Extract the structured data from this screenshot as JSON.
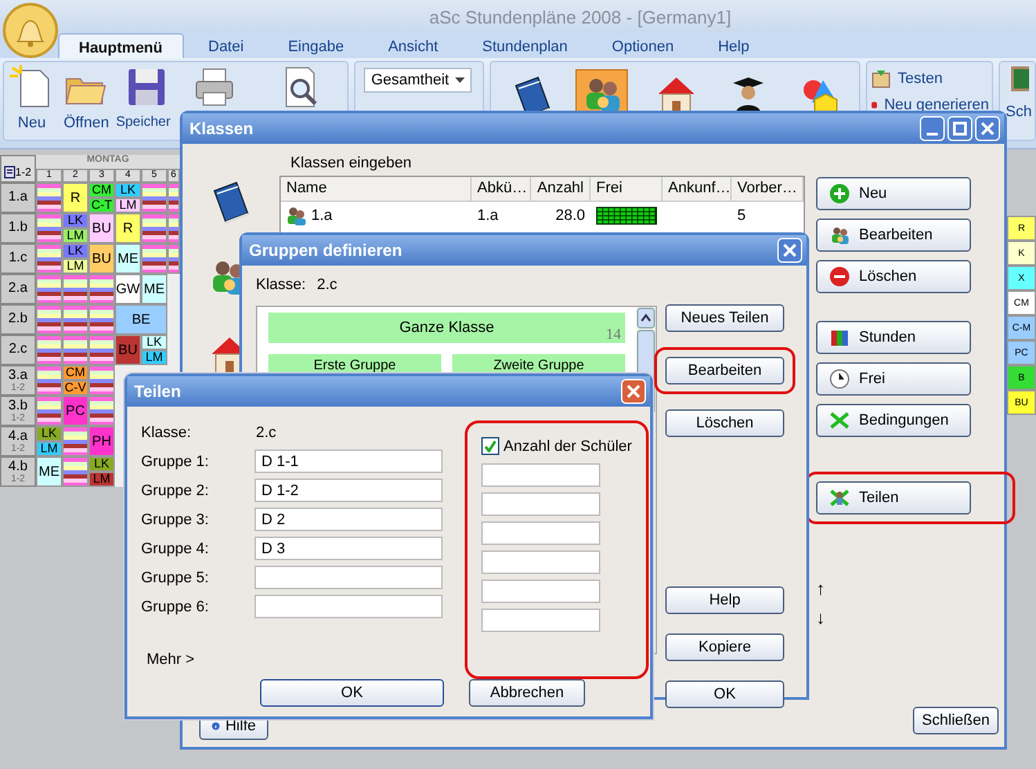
{
  "app": {
    "title": "aSc Stundenpläne 2008  - [Germany1]"
  },
  "tabs": [
    {
      "label": "Hauptmenü",
      "selected": true
    },
    {
      "label": "Datei",
      "selected": false
    },
    {
      "label": "Eingabe",
      "selected": false
    },
    {
      "label": "Ansicht",
      "selected": false
    },
    {
      "label": "Stundenplan",
      "selected": false
    },
    {
      "label": "Optionen",
      "selected": false
    },
    {
      "label": "Help",
      "selected": false
    }
  ],
  "ribbon": {
    "file_buttons": [
      "Neu",
      "Öffnen",
      "Speicher"
    ],
    "view_select": {
      "value": "Gesamtheit"
    },
    "data_buttons": [
      {
        "selected": false
      },
      {
        "selected": true
      },
      {
        "selected": false
      },
      {
        "selected": false
      },
      {
        "selected": false
      }
    ],
    "actions": [
      "Testen",
      "Neu generieren"
    ],
    "cut_button": "Sch"
  },
  "timetable": {
    "day": "MONTAG",
    "corner": "1-2",
    "periods": [
      "1",
      "2",
      "3",
      "4",
      "5",
      "6"
    ],
    "rows": [
      {
        "name": "1.a",
        "cells": [
          {
            "kind": "stripes"
          },
          {
            "kind": "block",
            "text": "R",
            "color": "#ffff66"
          },
          {
            "kind": "split",
            "parts": [
              {
                "text": "CM",
                "color": "#33ee33"
              },
              {
                "text": "C-T",
                "color": "#33ee33"
              }
            ]
          },
          {
            "kind": "split",
            "parts": [
              {
                "text": "LK",
                "color": "#33ccff"
              },
              {
                "text": "LM",
                "color": "#ffccff"
              }
            ]
          },
          {
            "kind": "stripes"
          },
          {
            "kind": "stripes"
          }
        ]
      },
      {
        "name": "1.b",
        "cells": [
          {
            "kind": "stripes"
          },
          {
            "kind": "split",
            "parts": [
              {
                "text": "LK",
                "color": "#7777ff"
              },
              {
                "text": "LM",
                "color": "#99ee66"
              }
            ]
          },
          {
            "kind": "block",
            "text": "BU",
            "color": "#ffccff"
          },
          {
            "kind": "block",
            "text": "R",
            "color": "#ffff66"
          },
          {
            "kind": "stripes"
          },
          {
            "kind": "stripes"
          }
        ]
      },
      {
        "name": "1.c",
        "cells": [
          {
            "kind": "stripes"
          },
          {
            "kind": "split",
            "parts": [
              {
                "text": "LK",
                "color": "#7777ff"
              },
              {
                "text": "LM",
                "color": "#eeff99"
              }
            ]
          },
          {
            "kind": "block",
            "text": "BU",
            "color": "#ffcc66"
          },
          {
            "kind": "block",
            "text": "ME",
            "color": "#ccffff"
          },
          {
            "kind": "stripes"
          },
          {
            "kind": "stripes"
          }
        ]
      },
      {
        "name": "2.a",
        "cells": [
          {
            "kind": "stripes"
          },
          {
            "kind": "stripes"
          },
          {
            "kind": "stripes"
          },
          {
            "kind": "block",
            "text": "GW",
            "color": "#ffffff"
          },
          {
            "kind": "block",
            "text": "ME",
            "color": "#ccffff"
          }
        ]
      },
      {
        "name": "2.b",
        "cells": [
          {
            "kind": "stripes"
          },
          {
            "kind": "stripes"
          },
          {
            "kind": "stripes"
          },
          {
            "kind": "wide",
            "text": "BE",
            "color": "#99ccff"
          }
        ]
      },
      {
        "name": "2.c",
        "cells": [
          {
            "kind": "stripes"
          },
          {
            "kind": "stripes"
          },
          {
            "kind": "stripes"
          },
          {
            "kind": "block",
            "text": "BU",
            "color": "#bb3333"
          },
          {
            "kind": "split",
            "parts": [
              {
                "text": "LK",
                "color": "#ccffff"
              },
              {
                "text": "LM",
                "color": "#33ccff"
              }
            ]
          }
        ]
      },
      {
        "name": "3.a",
        "sub": "1-2",
        "cells": [
          {
            "kind": "stripes"
          },
          {
            "kind": "split",
            "parts": [
              {
                "text": "CM",
                "color": "#ff9933"
              },
              {
                "text": "C-V",
                "color": "#ff9933"
              }
            ]
          },
          {
            "kind": "stripes"
          }
        ]
      },
      {
        "name": "3.b",
        "sub": "1-2",
        "cells": [
          {
            "kind": "stripes"
          },
          {
            "kind": "block",
            "text": "PC",
            "color": "#ff33cc"
          },
          {
            "kind": "stripes"
          }
        ]
      },
      {
        "name": "4.a",
        "sub": "1-2",
        "cells": [
          {
            "kind": "split",
            "parts": [
              {
                "text": "LK",
                "color": "#88aa22"
              },
              {
                "text": "LM",
                "color": "#33ccff"
              }
            ]
          },
          {
            "kind": "stripes"
          },
          {
            "kind": "block",
            "text": "PH",
            "color": "#ff33cc"
          }
        ]
      },
      {
        "name": "4.b",
        "sub": "1-2",
        "cells": [
          {
            "kind": "block",
            "text": "ME",
            "color": "#ccffff"
          },
          {
            "kind": "stripes"
          },
          {
            "kind": "split",
            "parts": [
              {
                "text": "LK",
                "color": "#88aa22"
              },
              {
                "text": "LM",
                "color": "#bb3333"
              }
            ]
          }
        ]
      }
    ]
  },
  "edge_strip": [
    {
      "text": "R",
      "color": "#ffff66"
    },
    {
      "text": "K",
      "color": "#ffffcc"
    },
    {
      "text": "X",
      "color": "#66ffff"
    },
    {
      "text": "CM",
      "color": "#ffffff"
    },
    {
      "text": "C-M",
      "color": "#99ccff"
    },
    {
      "text": "PC",
      "color": "#99ccff"
    },
    {
      "text": "B",
      "color": "#33dd33"
    },
    {
      "text": "BU",
      "color": "#ffff33"
    }
  ],
  "classes_window": {
    "title": "Klassen",
    "heading": "Klassen eingeben",
    "columns": [
      "Name",
      "Abkü…",
      "Anzahl",
      "Frei",
      "Ankunf…",
      "Vorber…"
    ],
    "rows": [
      {
        "name": "1.a",
        "short": "1.a",
        "count": "28.0",
        "prep": "5"
      }
    ],
    "button_groups": [
      [
        {
          "label": "Neu",
          "highlighted": false
        },
        {
          "label": "Bearbeiten",
          "highlighted": false
        },
        {
          "label": "Löschen",
          "highlighted": false
        }
      ],
      [
        {
          "label": "Stunden",
          "highlighted": false
        },
        {
          "label": "Frei",
          "highlighted": false
        },
        {
          "label": "Bedingungen",
          "highlighted": false
        }
      ],
      [
        {
          "label": "Teilen",
          "highlighted": true
        }
      ]
    ],
    "arrows": [
      "↑",
      "↓"
    ],
    "help": "Hilfe",
    "close": "Schließen"
  },
  "groups_window": {
    "title": "Gruppen definieren",
    "class_label": "Klasse:",
    "class_value": "2.c",
    "whole": {
      "label": "Ganze Klasse",
      "count": "14"
    },
    "groups": [
      "Erste Gruppe",
      "Zweite Gruppe"
    ],
    "buttons": [
      {
        "label": "Neues Teilen",
        "highlighted": false
      },
      {
        "label": "Bearbeiten",
        "highlighted": true
      },
      {
        "label": "Löschen",
        "highlighted": false
      }
    ],
    "lower_buttons": [
      "Help",
      "Kopiere",
      "OK"
    ]
  },
  "split_window": {
    "title": "Teilen",
    "class_label": "Klasse:",
    "class_value": "2.c",
    "count_toggle": {
      "label": "Anzahl der Schüler",
      "checked": true,
      "highlighted": true
    },
    "groups": [
      {
        "label": "Gruppe 1:",
        "value": "D 1-1"
      },
      {
        "label": "Gruppe 2:",
        "value": "D 1-2"
      },
      {
        "label": "Gruppe 3:",
        "value": "D 2"
      },
      {
        "label": "Gruppe 4:",
        "value": "D 3"
      },
      {
        "label": "Gruppe 5:"
      },
      {
        "label": "Gruppe 6:"
      }
    ],
    "more": "Mehr >",
    "buttons": [
      "OK",
      "Abbrechen"
    ]
  }
}
